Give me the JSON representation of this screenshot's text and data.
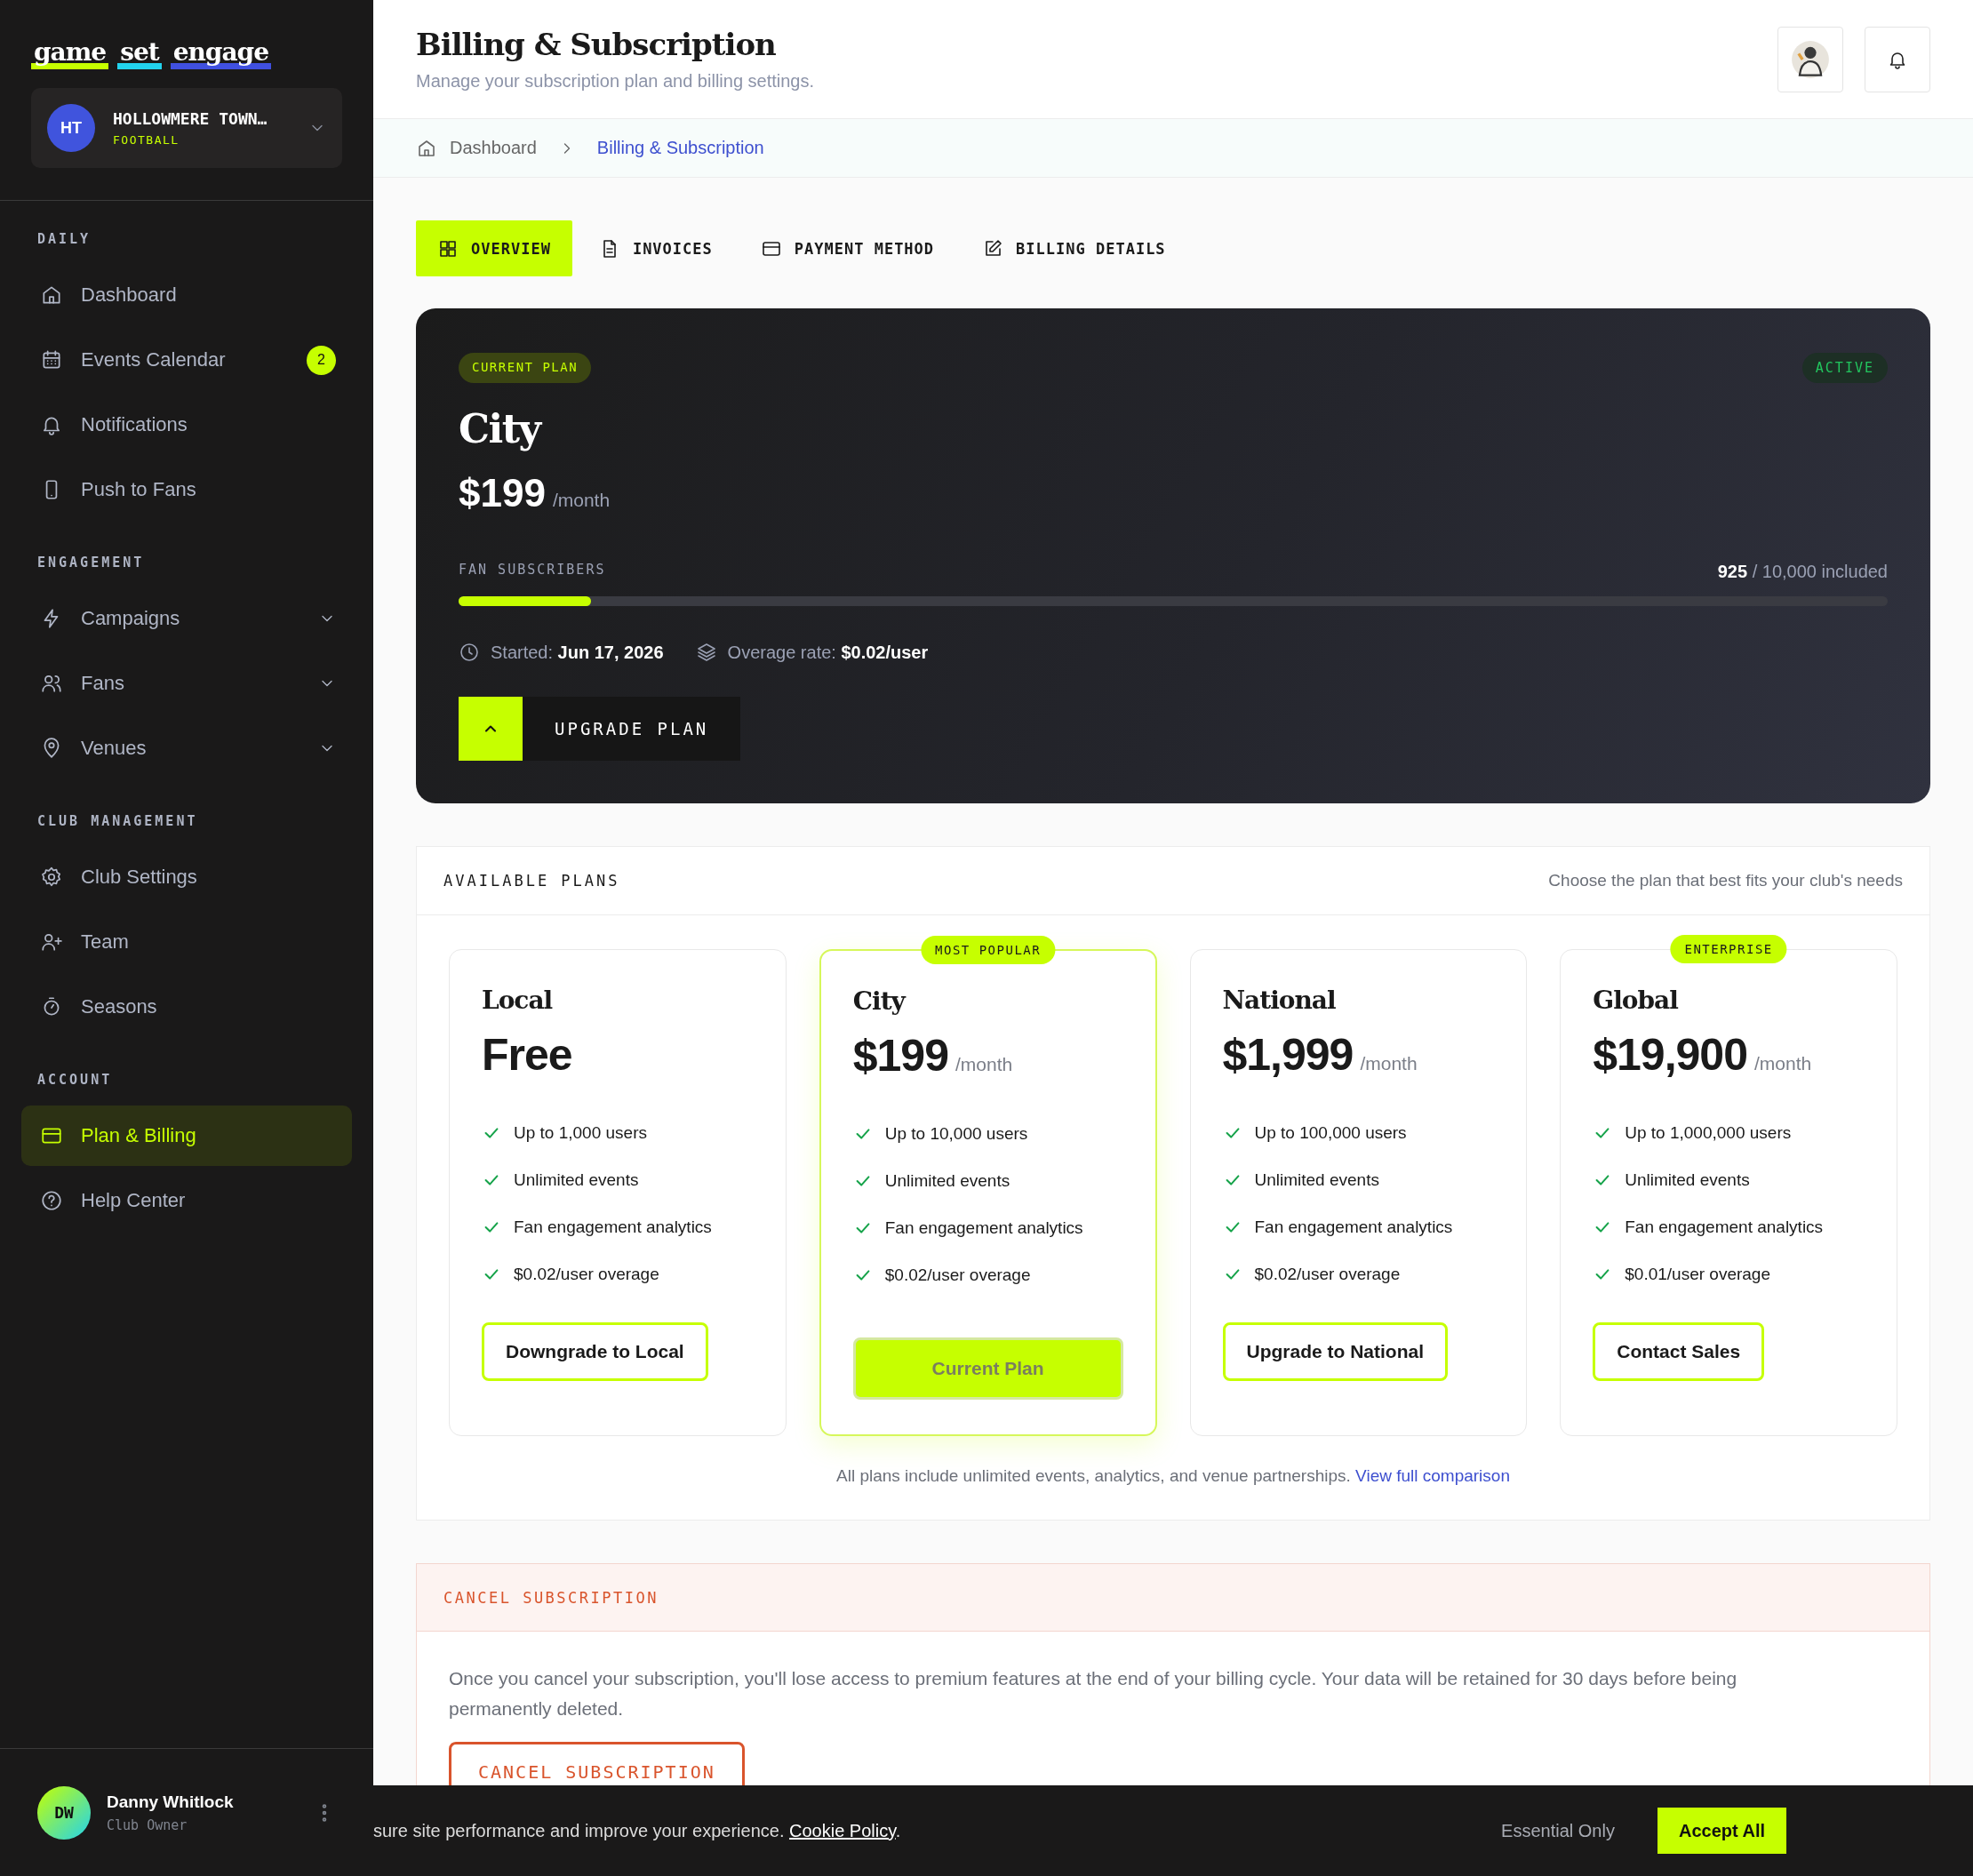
{
  "sidebar": {
    "logo": [
      {
        "text": "game",
        "color": "#c6ff00"
      },
      {
        "text": "set",
        "color": "#22d3ee"
      },
      {
        "text": "engage",
        "color": "#4050e0"
      }
    ],
    "club": {
      "initials": "HT",
      "name": "HOLLOWMERE TOWN…",
      "sport": "FOOTBALL"
    },
    "sections": [
      {
        "label": "DAILY",
        "items": [
          {
            "label": "Dashboard",
            "selected": false
          },
          {
            "label": "Events Calendar",
            "selected": false,
            "badge": "2"
          },
          {
            "label": "Notifications",
            "selected": false
          },
          {
            "label": "Push to Fans",
            "selected": false
          }
        ]
      },
      {
        "label": "ENGAGEMENT",
        "items": [
          {
            "label": "Campaigns",
            "selected": false,
            "expandable": true
          },
          {
            "label": "Fans",
            "selected": false,
            "expandable": true
          },
          {
            "label": "Venues",
            "selected": false,
            "expandable": true
          }
        ]
      },
      {
        "label": "CLUB MANAGEMENT",
        "items": [
          {
            "label": "Club Settings",
            "selected": false
          },
          {
            "label": "Team",
            "selected": false
          },
          {
            "label": "Seasons",
            "selected": false
          }
        ]
      },
      {
        "label": "ACCOUNT",
        "items": [
          {
            "label": "Plan & Billing",
            "selected": true
          },
          {
            "label": "Help Center",
            "selected": false
          }
        ]
      }
    ],
    "user": {
      "initials": "DW",
      "name": "Danny Whitlock",
      "role": "Club Owner"
    }
  },
  "header": {
    "title": "Billing & Subscription",
    "subtitle": "Manage your subscription plan and billing settings."
  },
  "breadcrumb": [
    {
      "label": "Dashboard",
      "current": false
    },
    {
      "label": "Billing & Subscription",
      "current": true
    }
  ],
  "tabs": [
    {
      "label": "OVERVIEW",
      "selected": true
    },
    {
      "label": "INVOICES",
      "selected": false
    },
    {
      "label": "PAYMENT METHOD",
      "selected": false
    },
    {
      "label": "BILLING DETAILS",
      "selected": false
    }
  ],
  "current_plan": {
    "badge": "CURRENT PLAN",
    "status": "ACTIVE",
    "name": "City",
    "price": "$199",
    "period": "/month",
    "usage": {
      "label": "FAN SUBSCRIBERS",
      "used": "925",
      "total": "/ 10,000 included",
      "level": 0.0925
    },
    "started_label": "Started:",
    "started_value": "Jun 17, 2026",
    "overage_label": "Overage rate:",
    "overage_value": "$0.02/user",
    "button": "UPGRADE PLAN"
  },
  "available_plans": {
    "title": "AVAILABLE PLANS",
    "subtitle": "Choose the plan that best fits your club's needs",
    "plans": [
      {
        "name": "Local",
        "price": "Free",
        "features": [
          "Up to 1,000 users",
          "Unlimited events",
          "Fan engagement analytics",
          "$0.02/user overage"
        ],
        "button": "Downgrade to Local",
        "current": false
      },
      {
        "name": "City",
        "price": "$199",
        "period": "/month",
        "ribbon": "MOST POPULAR",
        "features": [
          "Up to 10,000 users",
          "Unlimited events",
          "Fan engagement analytics",
          "$0.02/user overage"
        ],
        "button": "Current Plan",
        "current": true
      },
      {
        "name": "National",
        "price": "$1,999",
        "period": "/month",
        "features": [
          "Up to 100,000 users",
          "Unlimited events",
          "Fan engagement analytics",
          "$0.02/user overage"
        ],
        "button": "Upgrade to National",
        "current": false
      },
      {
        "name": "Global",
        "price": "$19,900",
        "period": "/month",
        "ribbon": "ENTERPRISE",
        "features": [
          "Up to 1,000,000 users",
          "Unlimited events",
          "Fan engagement analytics",
          "$0.01/user overage"
        ],
        "button": "Contact Sales",
        "current": false
      }
    ],
    "footnote": "All plans include unlimited events, analytics, and venue partnerships.",
    "footnote_link": "View full comparison"
  },
  "cancel": {
    "title": "CANCEL SUBSCRIPTION",
    "body": "Once you cancel your subscription, you'll lose access to premium features at the end of your billing cycle. Your data will be retained for 30 days before being permanently deleted.",
    "button": "CANCEL SUBSCRIPTION"
  },
  "cookie_banner": {
    "text": "sure site performance and improve your experience.",
    "link": "Cookie Policy",
    "after": ".",
    "buttons": [
      {
        "label": "Essential Only",
        "kind": "secondary"
      },
      {
        "label": "Accept All",
        "kind": "primary"
      }
    ]
  }
}
